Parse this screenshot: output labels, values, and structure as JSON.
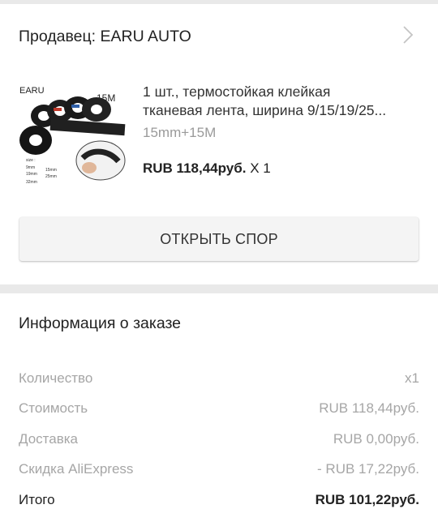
{
  "seller": {
    "label": "Продавец: EARU AUTO",
    "chevron_icon": "chevron-right-icon"
  },
  "product": {
    "title_line1": "1 шт., термостойкая клейкая",
    "title_line2": "тканевая лента, ширина 9/15/19/25...",
    "variant": "15mm+15M",
    "price": "RUB 118,44руб.",
    "quantity": "X 1",
    "image": {
      "brand": "EARU",
      "length_label": "15M",
      "size_heading": "size :",
      "size_9": "9mm",
      "size_15": "15mm",
      "size_19": "19mm",
      "size_25": "25mm",
      "size_32": "32mm"
    }
  },
  "dispute_button": {
    "label": "ОТКРЫТЬ СПОР"
  },
  "order_info": {
    "title": "Информация о заказе",
    "rows": [
      {
        "label": "Количество",
        "value": "x1"
      },
      {
        "label": "Стоимость",
        "value": "RUB 118,44руб."
      },
      {
        "label": "Доставка",
        "value": "RUB 0,00руб."
      },
      {
        "label": "Скидка AliExpress",
        "value": "- RUB 17,22руб."
      },
      {
        "label": "Итого",
        "value": "RUB 101,22руб."
      }
    ]
  }
}
